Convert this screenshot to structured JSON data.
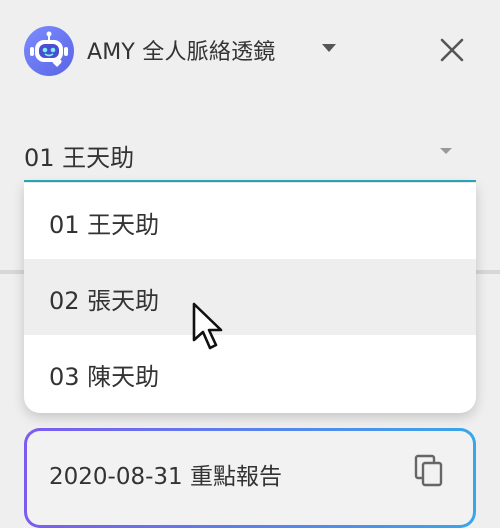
{
  "header": {
    "app_title": "AMY 全人脈絡透鏡",
    "logo_icon": "robot-logo-icon",
    "caret_icon": "caret-down-icon",
    "close_icon": "close-icon"
  },
  "person_select": {
    "value": "01 王天助",
    "accent_color": "#2aa8b8",
    "options": [
      {
        "label": "01 王天助"
      },
      {
        "label": "02 張天助"
      },
      {
        "label": "03 陳天助"
      }
    ],
    "hovered_index": 1
  },
  "report_card": {
    "label": "2020-08-31 重點報告",
    "copy_icon": "copy-icon",
    "gradient_start": "#7c5cf0",
    "gradient_end": "#3aa6ea"
  },
  "logo_color": "#6270ee",
  "pointer_icon": "mouse-pointer-icon"
}
